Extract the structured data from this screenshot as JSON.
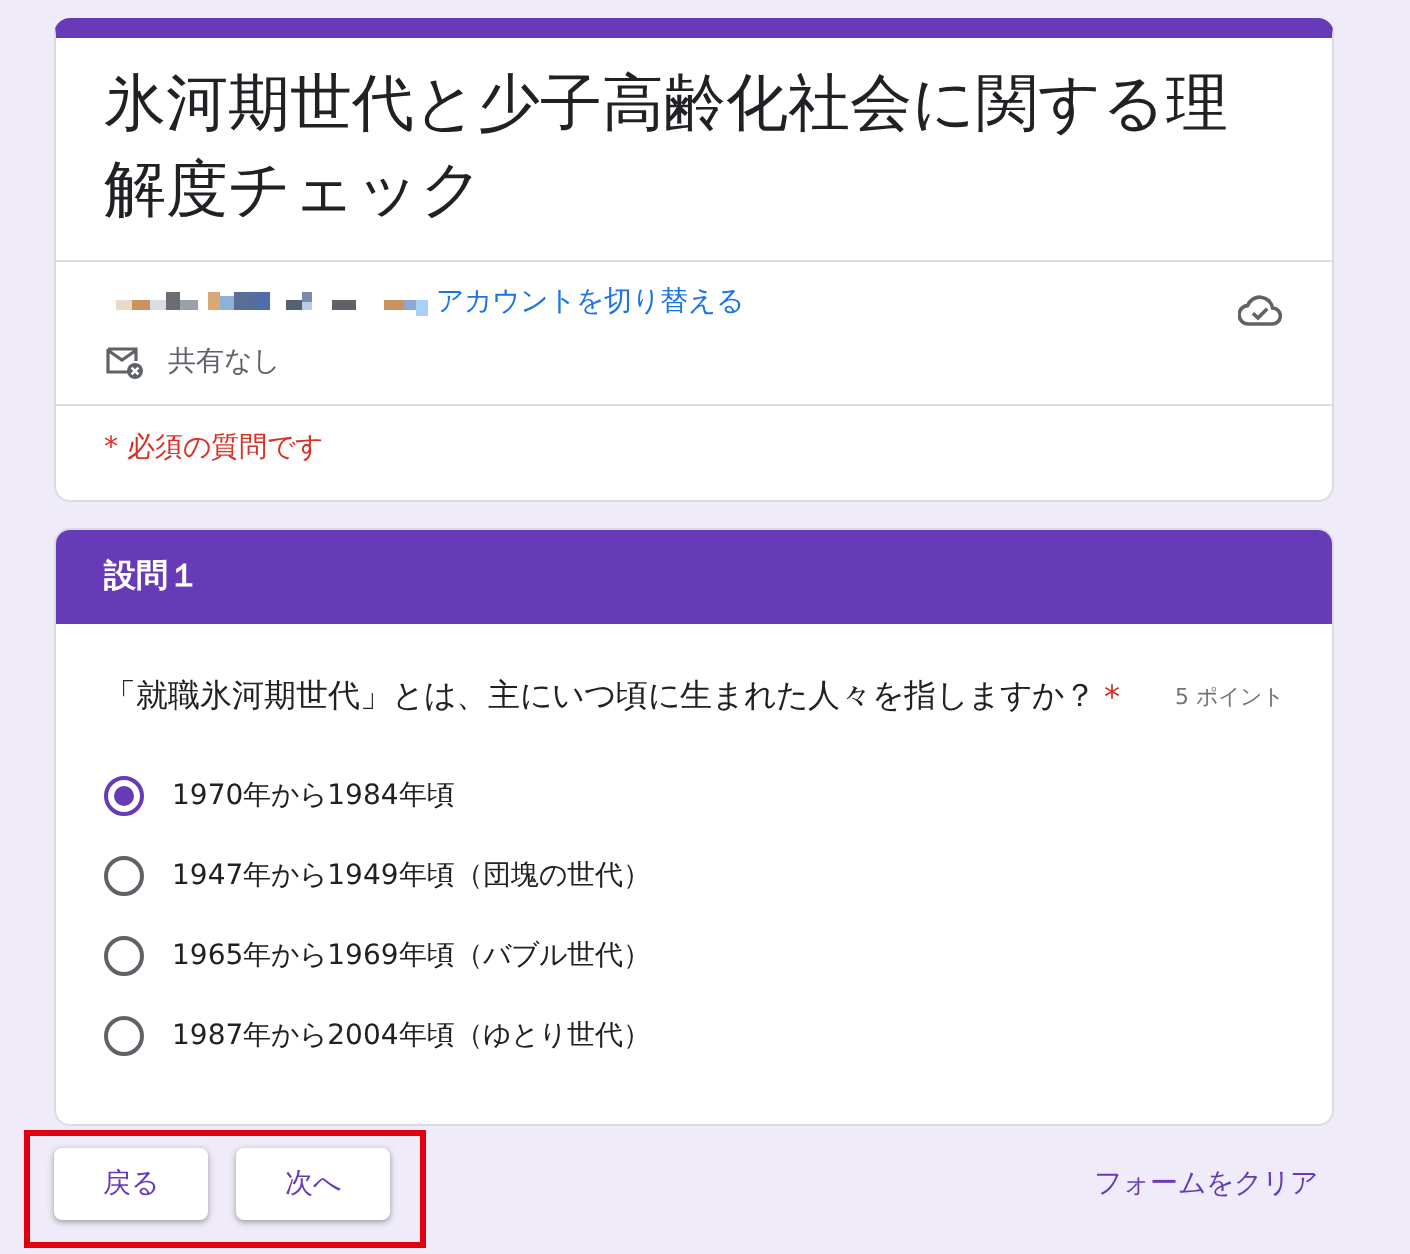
{
  "header_card": {
    "title": "氷河期世代と少子高齢化社会に関する理解度チェック",
    "account": {
      "switch_link": "アカウントを切り替える"
    },
    "sharing": "共有なし",
    "required_note": "* 必須の質問です"
  },
  "section": {
    "title": "設問１",
    "question": {
      "text": "「就職氷河期世代」とは、主にいつ頃に生まれた人々を指しますか？",
      "required_mark": "*",
      "points": "5 ポイント",
      "options": [
        {
          "label": "1970年から1984年頃",
          "selected": true
        },
        {
          "label": "1947年から1949年頃（団塊の世代）",
          "selected": false
        },
        {
          "label": "1965年から1969年頃（バブル世代）",
          "selected": false
        },
        {
          "label": "1987年から2004年頃（ゆとり世代）",
          "selected": false
        }
      ]
    }
  },
  "nav": {
    "highlighted": true,
    "buttons": [
      {
        "label": "戻る"
      },
      {
        "label": "次へ"
      }
    ],
    "clear_link": "フォームをクリア"
  }
}
